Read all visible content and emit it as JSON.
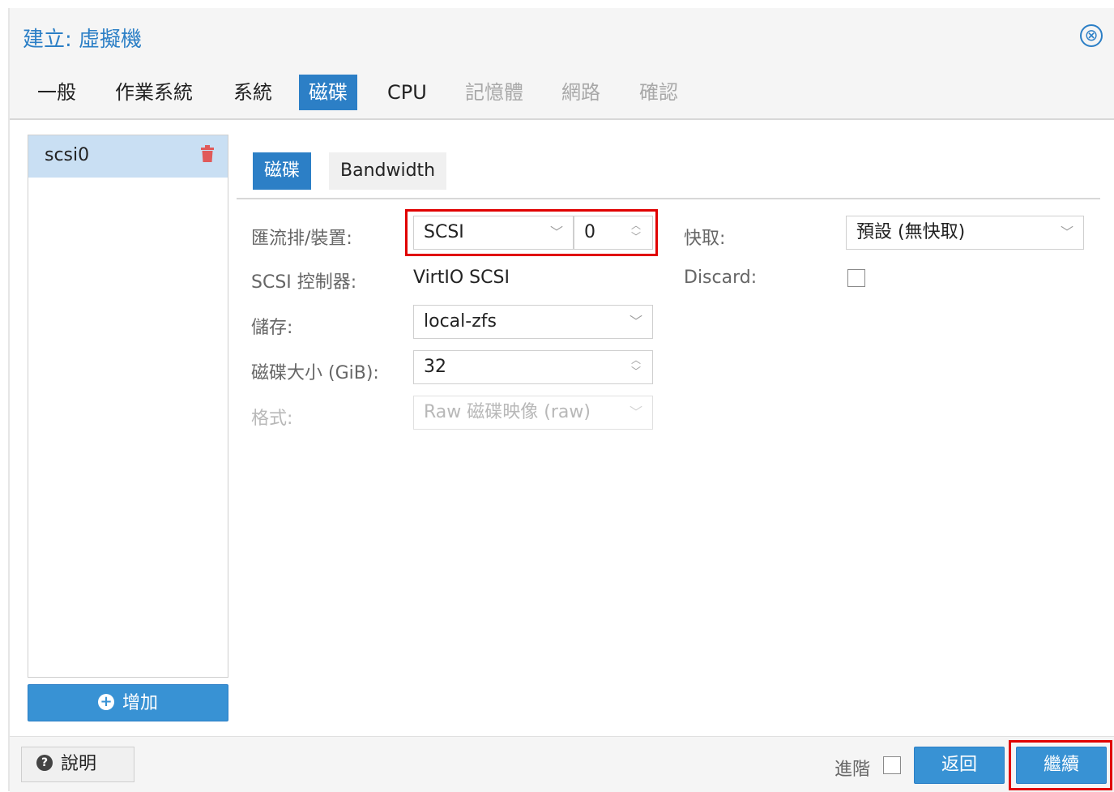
{
  "window": {
    "title": "建立: 虛擬機",
    "close_symbol": "⊗"
  },
  "tabs": [
    {
      "label": "一般",
      "state": "normal"
    },
    {
      "label": "作業系統",
      "state": "normal"
    },
    {
      "label": "系統",
      "state": "normal"
    },
    {
      "label": "磁碟",
      "state": "active"
    },
    {
      "label": "CPU",
      "state": "normal"
    },
    {
      "label": "記憶體",
      "state": "disabled"
    },
    {
      "label": "網路",
      "state": "disabled"
    },
    {
      "label": "確認",
      "state": "disabled"
    }
  ],
  "disk_list": {
    "items": [
      {
        "label": "scsi0",
        "selected": true
      }
    ],
    "add_label": "增加"
  },
  "inner_tabs": [
    {
      "label": "磁碟",
      "active": true
    },
    {
      "label": "Bandwidth",
      "active": false
    }
  ],
  "form": {
    "bus_device": {
      "label": "匯流排/裝置:",
      "bus_value": "SCSI",
      "device_value": "0"
    },
    "scsi_controller": {
      "label": "SCSI 控制器:",
      "value": "VirtIO SCSI"
    },
    "storage": {
      "label": "儲存:",
      "value": "local-zfs"
    },
    "disk_size": {
      "label": "磁碟大小 (GiB):",
      "value": "32"
    },
    "format": {
      "label": "格式:",
      "value": "Raw 磁碟映像 (raw)"
    },
    "cache": {
      "label": "快取:",
      "value": "預設 (無快取)"
    },
    "discard": {
      "label": "Discard:",
      "checked": false
    }
  },
  "footer": {
    "help_label": "說明",
    "advanced_label": "進階",
    "advanced_checked": false,
    "back_label": "返回",
    "next_label": "繼續"
  },
  "colors": {
    "accent": "#2c7fc6",
    "highlight": "#e00000",
    "selected_row": "#c9dff3",
    "delete": "#e05a5a"
  }
}
